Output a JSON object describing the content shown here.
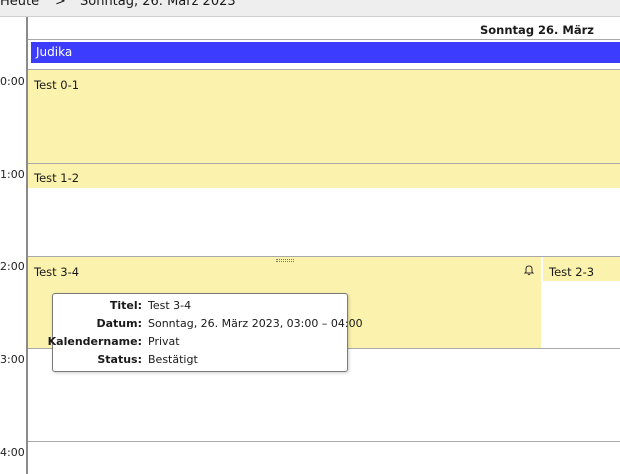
{
  "toolbar": {
    "today_label": "Heute",
    "nav_chevron": ">",
    "current_date": "Sonntag, 26. März 2023"
  },
  "timeline": {
    "hours": [
      "0:00",
      "1:00",
      "2:00",
      "3:00",
      "4:00"
    ]
  },
  "day": {
    "header": "Sonntag 26. März",
    "allday_event": "Judika"
  },
  "events": [
    {
      "title": "Test 0-1"
    },
    {
      "title": "Test 1-2"
    },
    {
      "title": "Test 3-4",
      "has_reminder": true
    },
    {
      "title": "Test 2-3"
    }
  ],
  "tooltip": {
    "rows": [
      {
        "label": "Titel:",
        "value": "Test 3-4"
      },
      {
        "label": "Datum:",
        "value": "Sonntag, 26. März 2023, 03:00 – 04:00"
      },
      {
        "label": "Kalendername:",
        "value": "Privat"
      },
      {
        "label": "Status:",
        "value": "Bestätigt"
      }
    ]
  },
  "colors": {
    "event_background": "#fbf3ad",
    "allday_background": "#3c3cff",
    "gutter_line": "#8a8a8a"
  },
  "icons": [
    "chevron-right-icon",
    "bell-icon"
  ]
}
